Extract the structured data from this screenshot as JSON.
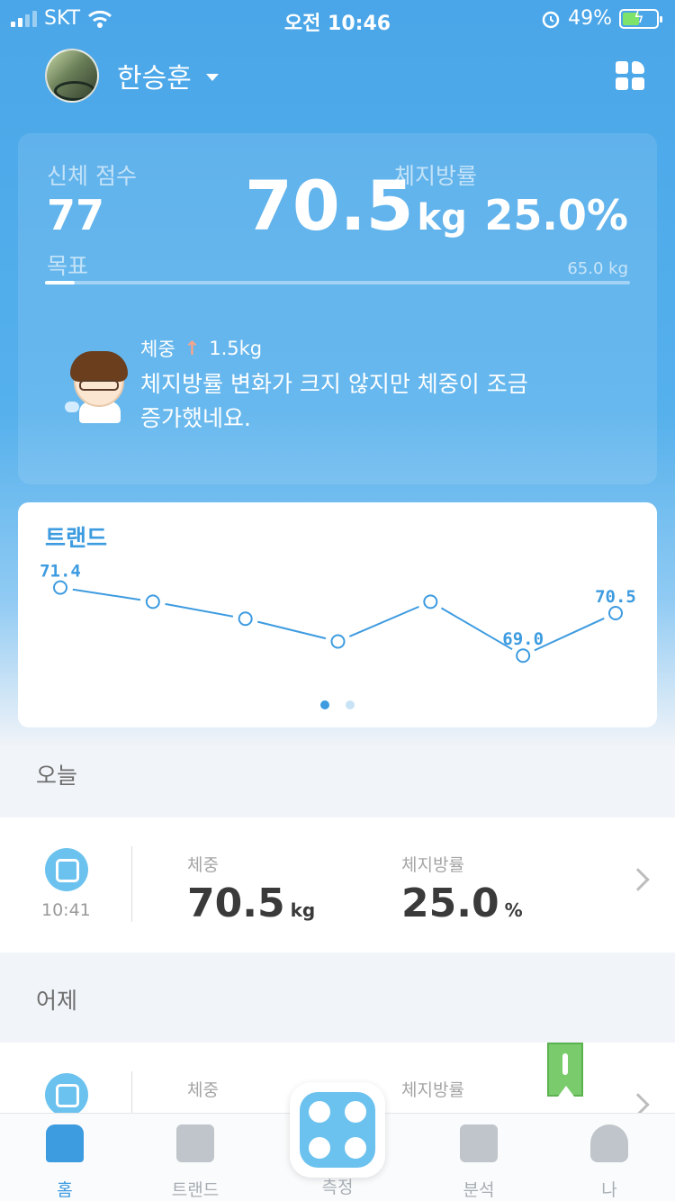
{
  "status_bar": {
    "carrier": "SKT",
    "time": "오전 10:46",
    "battery": "49%"
  },
  "header": {
    "user_name": "한승훈"
  },
  "summary": {
    "score_label": "신체 점수",
    "score": "77",
    "weight": "70.5",
    "weight_unit": "kg",
    "fat_label": "체지방률",
    "fat": "25.0%",
    "goal_label": "목표",
    "goal_value": "65.0 kg",
    "goal_progress": 0.05,
    "change_label": "체중",
    "change_arrow": "↑",
    "change_value": "1.5kg",
    "message": "체지방률 변화가 크지 않지만 체중이 조금 증가했네요."
  },
  "trend": {
    "title": "트랜드",
    "max_label": "71.4",
    "min_label": "69.0",
    "last_label": "70.5",
    "page_index": 0,
    "page_count": 2
  },
  "chart_data": {
    "type": "line",
    "title": "트랜드",
    "values": [
      71.4,
      70.9,
      70.3,
      69.5,
      70.9,
      69.0,
      70.5
    ],
    "labels_shown": [
      "71.4",
      "69.0",
      "70.5"
    ],
    "ylim": [
      68.5,
      71.8
    ]
  },
  "today": {
    "section": "오늘",
    "time": "10:41",
    "weight_label": "체중",
    "weight": "70.5",
    "weight_unit": "kg",
    "fat_label": "체지방률",
    "fat": "25.0",
    "fat_unit": "%"
  },
  "yesterday": {
    "section": "어제",
    "weight_label": "체중",
    "fat_label": "체지방률"
  },
  "tabs": [
    {
      "label": "홈",
      "icon": "home-icon"
    },
    {
      "label": "트랜드",
      "icon": "trend-icon"
    },
    {
      "label": "측정",
      "icon": "scale-icon"
    },
    {
      "label": "분석",
      "icon": "analysis-icon"
    },
    {
      "label": "나",
      "icon": "person-icon"
    }
  ],
  "colors": {
    "accent": "#3d9be0",
    "hero": "#4aa6e8",
    "scale": "#6cc2ef"
  }
}
